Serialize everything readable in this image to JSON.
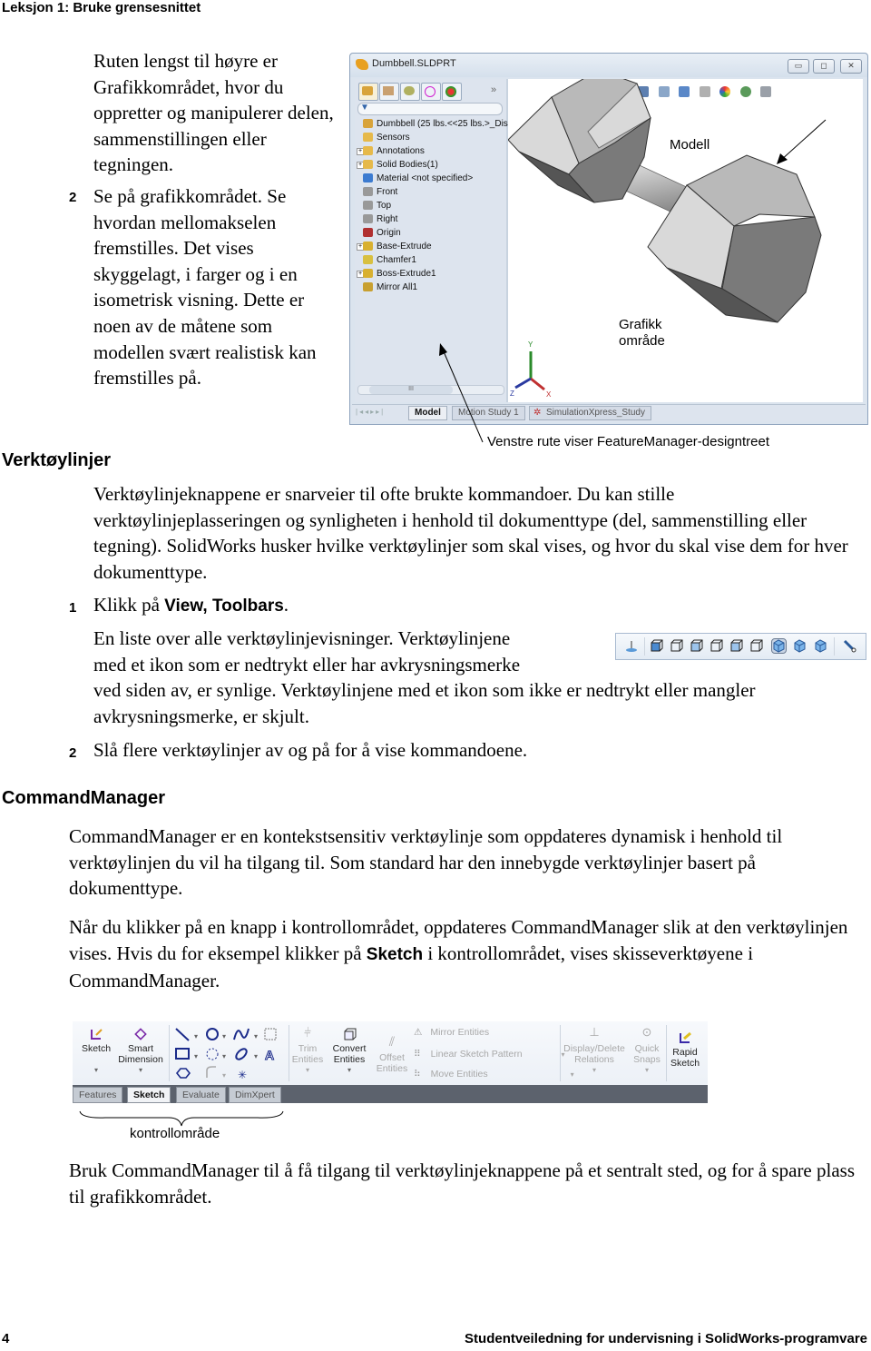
{
  "page_header": "Leksjon 1: Bruke grensesnittet",
  "intro": {
    "para": "Ruten lengst til høyre er Grafikkområdet, hvor du oppretter og manipulerer delen, sammenstillingen eller tegningen.",
    "step2_num": "2",
    "step2": "Se på grafikkområdet. Se hvordan mellomakselen fremstilles. Det vises skyggelagt, i farger og i en isometrisk visning. Dette er noen av de måtene som modellen svært realistisk kan fremstilles på."
  },
  "solidworks_window": {
    "title": "Dumbbell.SLDPRT",
    "window_buttons": [
      "minimize",
      "maximize",
      "close"
    ],
    "panel_tabs": [
      "FeatureManager",
      "PropertyManager",
      "ConfigurationManager",
      "DimXpertManager",
      "DisplayManager"
    ],
    "more_label": "»",
    "tree": [
      {
        "label": "Dumbbell  (25 lbs.<<25 lbs.>_Dis",
        "icon": "part-icon",
        "expand": false,
        "color": "#d8a33a"
      },
      {
        "label": "Sensors",
        "icon": "sensors-folder-icon",
        "expand": false,
        "color": "#e6b94a"
      },
      {
        "label": "Annotations",
        "icon": "annotations-icon",
        "expand": true,
        "color": "#e6b94a"
      },
      {
        "label": "Solid Bodies(1)",
        "icon": "solid-bodies-folder-icon",
        "expand": true,
        "color": "#e6b94a"
      },
      {
        "label": "Material <not specified>",
        "icon": "material-icon",
        "expand": false,
        "color": "#3c7bd0"
      },
      {
        "label": "Front",
        "icon": "plane-icon",
        "expand": false,
        "color": "#999999"
      },
      {
        "label": "Top",
        "icon": "plane-icon",
        "expand": false,
        "color": "#999999"
      },
      {
        "label": "Right",
        "icon": "plane-icon",
        "expand": false,
        "color": "#999999"
      },
      {
        "label": "Origin",
        "icon": "origin-icon",
        "expand": false,
        "color": "#b03030"
      },
      {
        "label": "Base-Extrude",
        "icon": "extrude-icon",
        "expand": true,
        "color": "#d8b030"
      },
      {
        "label": "Chamfer1",
        "icon": "chamfer-icon",
        "expand": false,
        "color": "#d8c040"
      },
      {
        "label": "Boss-Extrude1",
        "icon": "extrude-icon",
        "expand": true,
        "color": "#d8b030"
      },
      {
        "label": "Mirror All1",
        "icon": "mirror-icon",
        "expand": false,
        "color": "#c8a030"
      }
    ],
    "scroll_thumb": "III",
    "bottom_tabs": [
      "Model",
      "Motion Study 1",
      "SimulationXpress_Study"
    ],
    "active_bottom_tab": "Model",
    "annotation_model": "Modell",
    "annotation_graphics": "Grafikk område",
    "axis_labels": {
      "x": "X",
      "y": "Y",
      "z": "Z"
    }
  },
  "figure_caption": "Venstre rute viser FeatureManager-designtreet",
  "toolbars_section": {
    "heading": "Verktøylinjer",
    "para": "Verktøylinjeknappene er snarveier til ofte brukte kommandoer. Du kan stille verktøylinjeplasseringen og synligheten i henhold til dokumenttype (del, sammenstilling eller tegning). SolidWorks husker hvilke verktøylinjer som skal vises, og hvor du skal vise dem for hver dokumenttype.",
    "step1_num": "1",
    "step1_prefix": "Klikk på ",
    "step1_bold": "View, Toolbars",
    "step1_suffix": ".",
    "step1_desc_lines": [
      "En liste over alle verktøylinjevisninger. Verktøylinjene",
      "med et ikon som er nedtrykt eller har avkrysningsmerke"
    ],
    "step1_desc_rest": "ved siden av, er synlige. Verktøylinjene med et ikon som ikke er nedtrykt eller mangler avkrysningsmerke, er skjult.",
    "step2_num": "2",
    "step2": "Slå flere verktøylinjer av og på for å vise kommandoene.",
    "view_toolbar_icons": [
      "normal-to-icon",
      "isometric-icon",
      "trimetric-icon",
      "dimetric-icon",
      "front-view-icon",
      "back-view-icon",
      "left-view-icon",
      "shaded-view-icon",
      "top-view-icon",
      "right-view-icon",
      "section-view-icon"
    ],
    "view_toolbar_pressed": "shaded-view-icon"
  },
  "commandmanager_section": {
    "heading": "CommandManager",
    "para1": "CommandManager er en kontekstsensitiv verktøylinje som oppdateres dynamisk i henhold til verktøylinjen du vil ha tilgang til. Som standard har den innebygde verktøylinjer basert på dokumenttype.",
    "para2_prefix": "Når du klikker på en knapp i kontrollområdet, oppdateres CommandManager slik at den verktøylinjen vises. Hvis du for eksempel klikker på ",
    "para2_bold": "Sketch",
    "para2_suffix": " i kontrollområdet, vises skisseverktøyene i CommandManager.",
    "buttons": {
      "sketch": "Sketch",
      "smart_dimension": [
        "Smart",
        "Dimension"
      ],
      "trim_entities": [
        "Trim",
        "Entities"
      ],
      "convert_entities": [
        "Convert",
        "Entities"
      ],
      "offset_entities": [
        "Offset",
        "Entities"
      ],
      "mirror_entities": "Mirror Entities",
      "linear_sketch_pattern": "Linear Sketch Pattern",
      "move_entities": "Move Entities",
      "display_delete_relations": [
        "Display/Delete",
        "Relations"
      ],
      "quick_snaps": [
        "Quick",
        "Snaps"
      ],
      "rapid_sketch": [
        "Rapid",
        "Sketch"
      ]
    },
    "tabs": [
      "Features",
      "Sketch",
      "Evaluate",
      "DimXpert"
    ],
    "active_tab": "Sketch",
    "brace_label": "kontrollområde",
    "para3": "Bruk CommandManager til å få tilgang til verktøylinjeknappene på et sentralt sted, og for å spare plass til grafikkområdet."
  },
  "footer": {
    "page_number": "4",
    "title": "Studentveiledning for undervisning i SolidWorks-programvare"
  }
}
